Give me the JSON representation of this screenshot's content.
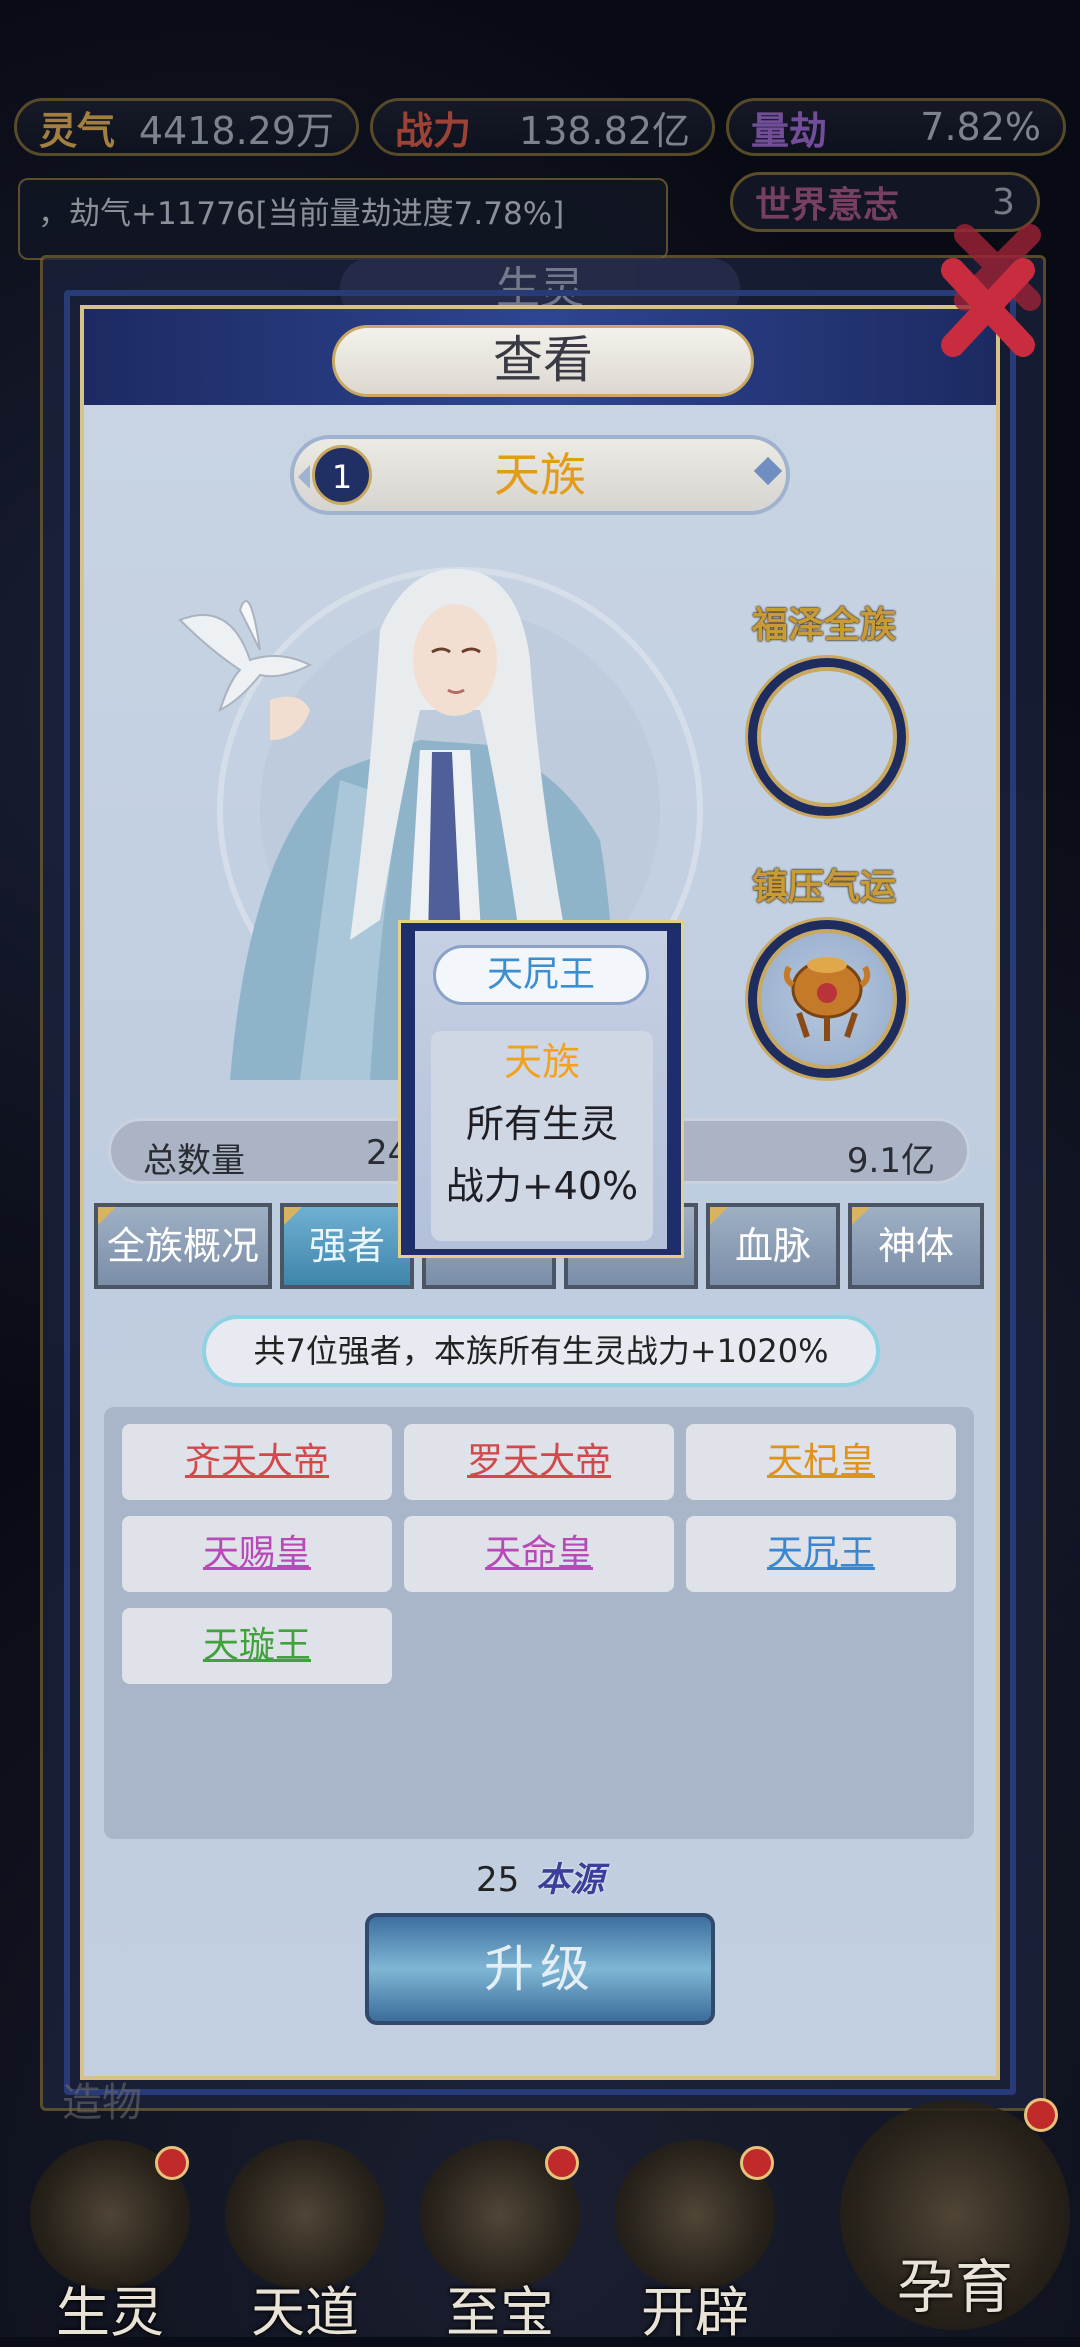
{
  "hud": {
    "lingqi_label": "灵气",
    "lingqi_value": "4418.29万",
    "zhanli_label": "战力",
    "zhanli_value": "138.82亿",
    "liangjie_label": "量劫",
    "liangjie_value": "7.82%",
    "ticker": "，劫气+11776[当前量劫进度7.78%]",
    "world_will_label": "世界意志",
    "world_will_value": "3"
  },
  "back_panel": {
    "title": "生灵"
  },
  "dialog": {
    "title": "查看",
    "race": {
      "index": "1",
      "name": "天族"
    },
    "blessing_label": "福泽全族",
    "suppress_label": "镇压气运",
    "count": {
      "label": "总数量",
      "mid_value": "24",
      "total_value": "9.1亿"
    },
    "tabs": [
      {
        "label": "全族概况"
      },
      {
        "label": "强者"
      },
      {
        "label": ""
      },
      {
        "label": ""
      },
      {
        "label": "血脉"
      },
      {
        "label": "神体"
      }
    ],
    "info": "共7位强者，本族所有生灵战力+1020%",
    "strongmen": [
      {
        "name": "齐天大帝",
        "color": "#d3484a"
      },
      {
        "name": "罗天大帝",
        "color": "#d3484a"
      },
      {
        "name": "天杞皇",
        "color": "#e0921b"
      },
      {
        "name": "天赐皇",
        "color": "#b84ab8"
      },
      {
        "name": "天命皇",
        "color": "#b84ab8"
      },
      {
        "name": "天凥王",
        "color": "#3a86cf"
      },
      {
        "name": "天璇王",
        "color": "#3fa23a"
      }
    ],
    "cost_amount": "25",
    "cost_resource": "本源",
    "upgrade_label": "升级"
  },
  "popup": {
    "title": "天凥王",
    "race": "天族",
    "target": "所有生灵",
    "effect": "战力+40%"
  },
  "faint_text": "造物",
  "nav": [
    {
      "label": "生灵"
    },
    {
      "label": "天道"
    },
    {
      "label": "至宝"
    },
    {
      "label": "开辟"
    },
    {
      "label": "孕育"
    }
  ]
}
